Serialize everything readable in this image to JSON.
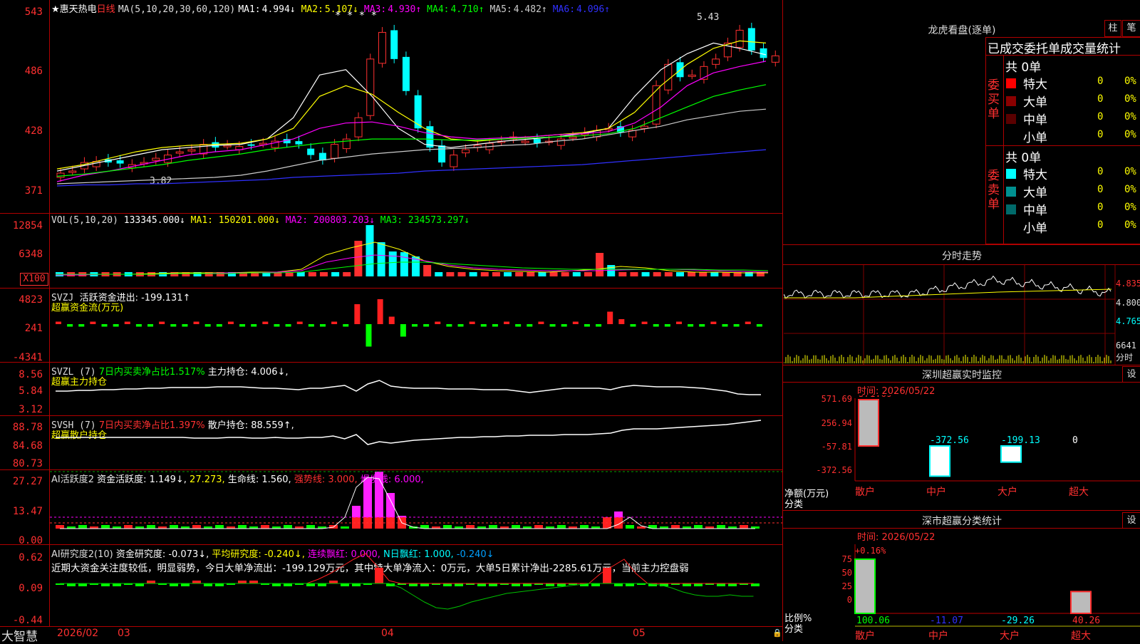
{
  "main": {
    "stock_title": "★惠天热电",
    "period": "日线",
    "ma_params": "MA(5,10,20,30,60,120)",
    "ma": [
      {
        "label": "MA1:",
        "value": "4.994↓",
        "color": "#ffffff"
      },
      {
        "label": "MA2:",
        "value": "5.107↓",
        "color": "#ffff00"
      },
      {
        "label": "MA3:",
        "value": "4.930↑",
        "color": "#ff00ff"
      },
      {
        "label": "MA4:",
        "value": "4.710↑",
        "color": "#00ff00"
      },
      {
        "label": "MA5:",
        "value": "4.482↑",
        "color": "#cccccc"
      },
      {
        "label": "MA6:",
        "value": "4.096↑",
        "color": "#3030ff"
      }
    ],
    "y_ticks": [
      "543",
      "486",
      "428",
      "371"
    ],
    "high_mark": "5.43",
    "low_mark": "3.82"
  },
  "vol": {
    "params": "VOL(5,10,20)",
    "value": "133345.000↓",
    "ma1": "MA1: 150201.000↓",
    "ma2": "MA2: 200803.203↓",
    "ma3": "MA3: 234573.297↓",
    "y_ticks": [
      "12854",
      "6348"
    ],
    "unit": "X100"
  },
  "svzj": {
    "name": "SVZJ",
    "label": "活跃资金进出: -199.131↑",
    "sub": "超赢资金流(万元)",
    "y_ticks": [
      "4823",
      "241",
      "-4341"
    ]
  },
  "svzl": {
    "name": "SVZL (7)",
    "ratio": "7日内买卖净占比1.517%",
    "hold": "主力持仓: 4.006↓,",
    "sub": "超赢主力持仓",
    "y_ticks": [
      "8.56",
      "5.84",
      "3.12"
    ]
  },
  "svsh": {
    "name": "SVSH (7)",
    "ratio": "7日内买卖净占比1.397%",
    "hold": "散户持仓: 88.559↑,",
    "sub": "超赢散户持仓",
    "y_ticks": [
      "88.78",
      "84.68",
      "80.73"
    ]
  },
  "ai1": {
    "name": "AI活跃度2",
    "a": "资金活跃度: 1.149↓,",
    "b": "27.273,",
    "c": "生命线: 1.560,",
    "d": "强势线: 3.000,",
    "e": "爆发线: 6.000,",
    "y_ticks": [
      "27.27",
      "13.47",
      "0.00"
    ]
  },
  "ai2": {
    "name": "AI研究度2(10)",
    "a": "资金研究度: -0.073↓,",
    "b": "平均研究度: -0.240↓,",
    "c": "连续飘红: 0.000,",
    "d": "N日飘红: 1.000,",
    "e": "-0.240↓",
    "note": "近期大资金关注度较低，明显弱势，今日大单净流出：-199.129万元，其中特大单净流入：0万元，大单5日累计净出-2285.61万元，当前主力控盘弱",
    "y_ticks": [
      "0.62",
      "0.09",
      "-0.44"
    ]
  },
  "bottom": {
    "brand": "大智慧",
    "dates": [
      "2026/02",
      "03",
      "04",
      "05"
    ]
  },
  "dragon": {
    "title": "龙虎看盘(逐单)",
    "btn1": "柱",
    "btn2": "笔",
    "header": "已成交委托单成交量统计",
    "buy": {
      "side": "委买单",
      "total": "共 0单",
      "rows": [
        {
          "name": "特大",
          "val": "0",
          "pct": "0%",
          "color": "#ff0000"
        },
        {
          "name": "大单",
          "val": "0",
          "pct": "0%",
          "color": "#8b0000"
        },
        {
          "name": "中单",
          "val": "0",
          "pct": "0%",
          "color": "#5a0000"
        },
        {
          "name": "小单",
          "val": "0",
          "pct": "0%",
          "color": "#000000"
        }
      ]
    },
    "sell": {
      "side": "委卖单",
      "total": "共 0单",
      "rows": [
        {
          "name": "特大",
          "val": "0",
          "pct": "0%",
          "color": "#00ffff"
        },
        {
          "name": "大单",
          "val": "0",
          "pct": "0%",
          "color": "#009090"
        },
        {
          "name": "中单",
          "val": "0",
          "pct": "0%",
          "color": "#006a6a"
        },
        {
          "name": "小单",
          "val": "0",
          "pct": "0%",
          "color": "#000000"
        }
      ]
    }
  },
  "intraday": {
    "title": "分时走势",
    "y_ticks": [
      "4.835",
      "4.800",
      "4.765"
    ],
    "vol_label": "6641",
    "vol_sub": "分时"
  },
  "monitor": {
    "title": "深圳超赢实时监控",
    "btn": "设",
    "time": "时间: 2026/05/22",
    "y_ticks": [
      "571.69",
      "256.94",
      "-57.81",
      "-372.56"
    ],
    "y_label": "净额(万元)",
    "x_label": "分类",
    "bars": [
      {
        "cat": "散户",
        "value": 571.69,
        "label": "571.69"
      },
      {
        "cat": "中户",
        "value": -372.56,
        "label": "-372.56"
      },
      {
        "cat": "大户",
        "value": -199.13,
        "label": "-199.13"
      },
      {
        "cat": "超大",
        "value": 0,
        "label": "0"
      }
    ]
  },
  "classify": {
    "title": "深市超赢分类统计",
    "btn": "设",
    "time": "时间: 2026/05/22",
    "top_label": "+0.16%",
    "y_ticks": [
      "75",
      "50",
      "25",
      "0"
    ],
    "y_label": "比例%",
    "x_label": "分类",
    "bars": [
      {
        "cat": "散户",
        "value": 100.06,
        "label": "100.06"
      },
      {
        "cat": "中户",
        "value": -11.07,
        "label": "-11.07"
      },
      {
        "cat": "大户",
        "value": -29.26,
        "label": "-29.26"
      },
      {
        "cat": "超大",
        "value": 40.26,
        "label": "40.26"
      }
    ]
  }
}
